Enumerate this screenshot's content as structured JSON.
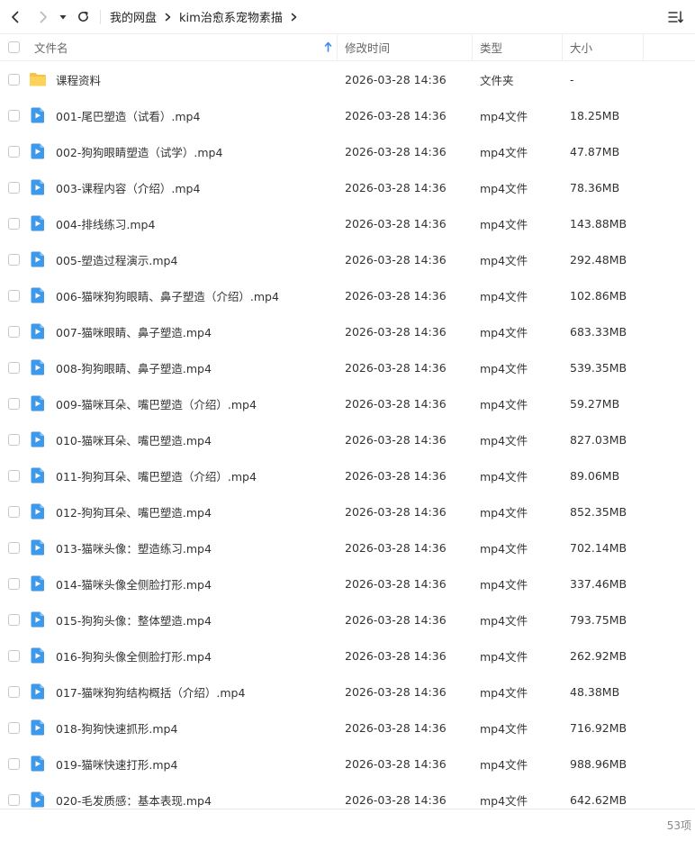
{
  "toolbar": {
    "breadcrumb": [
      "我的网盘",
      "kim治愈系宠物素描"
    ]
  },
  "table": {
    "headers": {
      "name": "文件名",
      "time": "修改时间",
      "type": "类型",
      "size": "大小"
    },
    "rows": [
      {
        "icon": "folder-icon",
        "name": "课程资料",
        "time": "2026-03-28 14:36",
        "type": "文件夹",
        "size": "-"
      },
      {
        "icon": "video-file-icon",
        "name": "001-尾巴塑造（试看）.mp4",
        "time": "2026-03-28 14:36",
        "type": "mp4文件",
        "size": "18.25MB"
      },
      {
        "icon": "video-file-icon",
        "name": "002-狗狗眼睛塑造（试学）.mp4",
        "time": "2026-03-28 14:36",
        "type": "mp4文件",
        "size": "47.87MB"
      },
      {
        "icon": "video-file-icon",
        "name": "003-课程内容（介绍）.mp4",
        "time": "2026-03-28 14:36",
        "type": "mp4文件",
        "size": "78.36MB"
      },
      {
        "icon": "video-file-icon",
        "name": "004-排线练习.mp4",
        "time": "2026-03-28 14:36",
        "type": "mp4文件",
        "size": "143.88MB"
      },
      {
        "icon": "video-file-icon",
        "name": "005-塑造过程演示.mp4",
        "time": "2026-03-28 14:36",
        "type": "mp4文件",
        "size": "292.48MB"
      },
      {
        "icon": "video-file-icon",
        "name": "006-猫咪狗狗眼睛、鼻子塑造（介绍）.mp4",
        "time": "2026-03-28 14:36",
        "type": "mp4文件",
        "size": "102.86MB"
      },
      {
        "icon": "video-file-icon",
        "name": "007-猫咪眼睛、鼻子塑造.mp4",
        "time": "2026-03-28 14:36",
        "type": "mp4文件",
        "size": "683.33MB"
      },
      {
        "icon": "video-file-icon",
        "name": "008-狗狗眼睛、鼻子塑造.mp4",
        "time": "2026-03-28 14:36",
        "type": "mp4文件",
        "size": "539.35MB"
      },
      {
        "icon": "video-file-icon",
        "name": "009-猫咪耳朵、嘴巴塑造（介绍）.mp4",
        "time": "2026-03-28 14:36",
        "type": "mp4文件",
        "size": "59.27MB"
      },
      {
        "icon": "video-file-icon",
        "name": "010-猫咪耳朵、嘴巴塑造.mp4",
        "time": "2026-03-28 14:36",
        "type": "mp4文件",
        "size": "827.03MB"
      },
      {
        "icon": "video-file-icon",
        "name": "011-狗狗耳朵、嘴巴塑造（介绍）.mp4",
        "time": "2026-03-28 14:36",
        "type": "mp4文件",
        "size": "89.06MB"
      },
      {
        "icon": "video-file-icon",
        "name": "012-狗狗耳朵、嘴巴塑造.mp4",
        "time": "2026-03-28 14:36",
        "type": "mp4文件",
        "size": "852.35MB"
      },
      {
        "icon": "video-file-icon",
        "name": "013-猫咪头像：塑造练习.mp4",
        "time": "2026-03-28 14:36",
        "type": "mp4文件",
        "size": "702.14MB"
      },
      {
        "icon": "video-file-icon",
        "name": "014-猫咪头像全侧脸打形.mp4",
        "time": "2026-03-28 14:36",
        "type": "mp4文件",
        "size": "337.46MB"
      },
      {
        "icon": "video-file-icon",
        "name": "015-狗狗头像：整体塑造.mp4",
        "time": "2026-03-28 14:36",
        "type": "mp4文件",
        "size": "793.75MB"
      },
      {
        "icon": "video-file-icon",
        "name": "016-狗狗头像全侧脸打形.mp4",
        "time": "2026-03-28 14:36",
        "type": "mp4文件",
        "size": "262.92MB"
      },
      {
        "icon": "video-file-icon",
        "name": "017-猫咪狗狗结构概括（介绍）.mp4",
        "time": "2026-03-28 14:36",
        "type": "mp4文件",
        "size": "48.38MB"
      },
      {
        "icon": "video-file-icon",
        "name": "018-狗狗快速抓形.mp4",
        "time": "2026-03-28 14:36",
        "type": "mp4文件",
        "size": "716.92MB"
      },
      {
        "icon": "video-file-icon",
        "name": "019-猫咪快速打形.mp4",
        "time": "2026-03-28 14:36",
        "type": "mp4文件",
        "size": "988.96MB"
      },
      {
        "icon": "video-file-icon",
        "name": "020-毛发质感：基本表现.mp4",
        "time": "2026-03-28 14:36",
        "type": "mp4文件",
        "size": "642.62MB"
      }
    ]
  },
  "status": {
    "count": "53项"
  },
  "colors": {
    "accent": "#3b8cf0",
    "folder": "#f7c244",
    "video": "#3e99ea"
  }
}
